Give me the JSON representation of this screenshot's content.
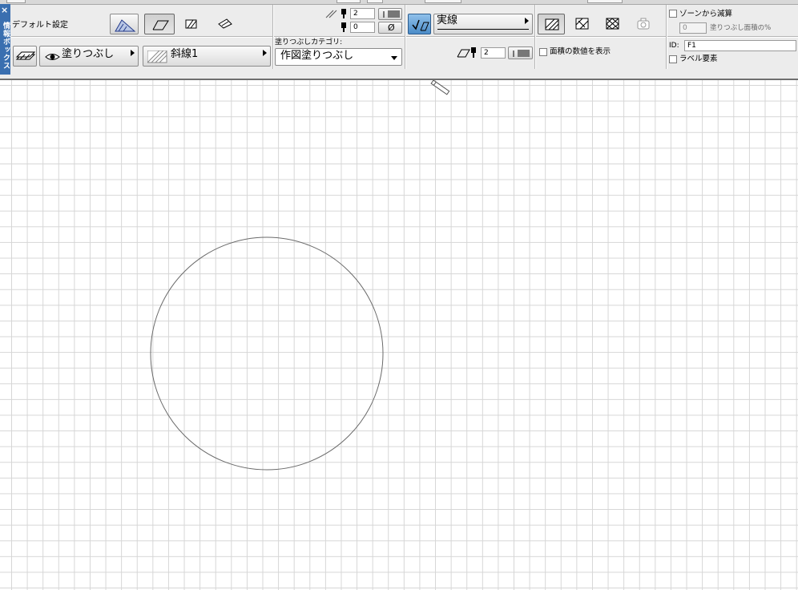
{
  "palette": {
    "title": "情報ボックス",
    "close": "×"
  },
  "settings": {
    "label": "デフォルト設定"
  },
  "fill": {
    "type_label": "塗りつぶし",
    "pattern_label": "斜線1"
  },
  "pens": {
    "fill_pen": "2",
    "background_pen": "0",
    "background_none": "Ø",
    "contour_pen": "2"
  },
  "category": {
    "label": "塗りつぶしカテゴリ:",
    "value": "作図塗りつぶし"
  },
  "line": {
    "type_label": "実線"
  },
  "area": {
    "show_area_label": "面積の数値を表示"
  },
  "zone": {
    "subtract_label": "ゾーンから減算",
    "percent_value": "0",
    "percent_label": "塗りつぶし面積の%"
  },
  "element": {
    "id_label": "ID:",
    "id_value": "F1",
    "label_element": "ラベル要素"
  }
}
